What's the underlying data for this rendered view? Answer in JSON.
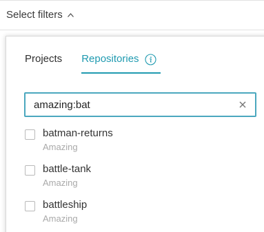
{
  "header": {
    "label": "Select filters"
  },
  "tabs": [
    {
      "label": "Projects",
      "active": false
    },
    {
      "label": "Repositories",
      "active": true
    }
  ],
  "search": {
    "value": "amazing:bat",
    "placeholder": ""
  },
  "results": [
    {
      "name": "batman-returns",
      "project": "Amazing",
      "checked": false
    },
    {
      "name": "battle-tank",
      "project": "Amazing",
      "checked": false
    },
    {
      "name": "battleship",
      "project": "Amazing",
      "checked": false
    }
  ],
  "icons": {
    "header_toggle": "chevron-up-icon",
    "tab_info": "info-icon",
    "search_clear": "close-icon"
  },
  "colors": {
    "accent": "#1f9ab0",
    "search_border": "#4aa7be",
    "muted_text": "#a9a9a9"
  }
}
